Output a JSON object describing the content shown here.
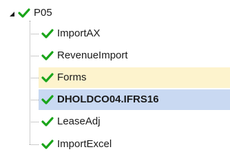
{
  "tree": {
    "root": {
      "label": "P05",
      "status_icon": "green-checkmark-icon",
      "expander_icon": "expanded-triangle-icon"
    },
    "children": [
      {
        "label": "ImportAX",
        "status_icon": "green-checkmark-icon",
        "state": "normal"
      },
      {
        "label": "RevenueImport",
        "status_icon": "green-checkmark-icon",
        "state": "normal"
      },
      {
        "label": "Forms",
        "status_icon": "green-checkmark-icon",
        "state": "hover"
      },
      {
        "label": "DHOLDCO04.IFRS16",
        "status_icon": "green-checkmark-icon",
        "state": "selected"
      },
      {
        "label": "LeaseAdj",
        "status_icon": "green-checkmark-icon",
        "state": "normal"
      },
      {
        "label": "ImportExcel",
        "status_icon": "green-checkmark-icon",
        "state": "normal"
      }
    ]
  },
  "colors": {
    "check": "#1aa51a",
    "hover_background": "#fdf3cd",
    "selected_background": "#c9d9f2",
    "tree_lines": "#9a9a9a"
  }
}
